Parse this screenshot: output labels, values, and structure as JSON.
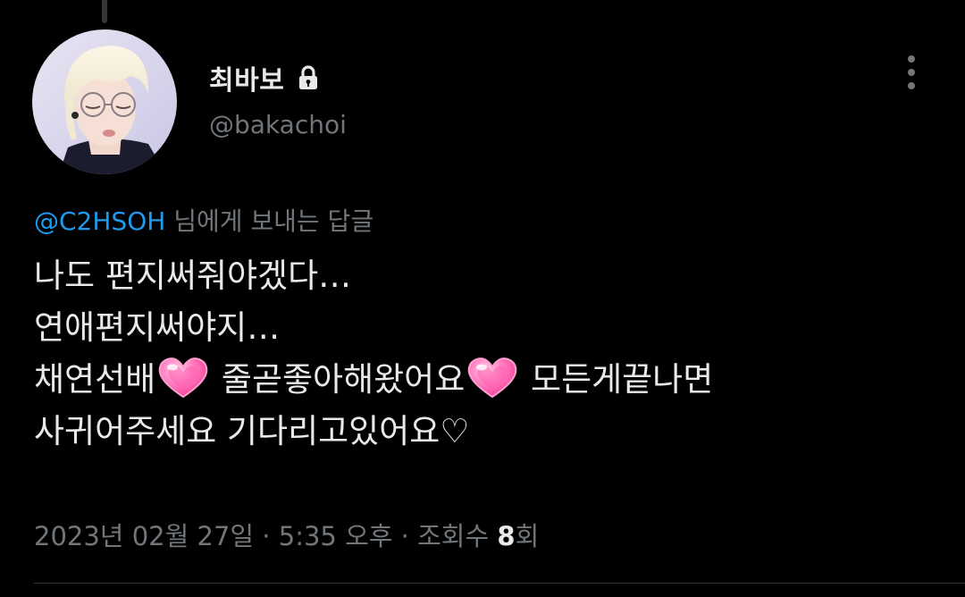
{
  "tweet": {
    "author": {
      "display_name": "최바보",
      "handle": "@bakachoi",
      "protected_icon": "lock-icon",
      "avatar": "profile-photo"
    },
    "more_icon": "more-vertical-icon",
    "reply_to": {
      "mention": "@C2HSOH",
      "suffix": " 님에게 보내는 답글"
    },
    "text": {
      "line1": "나도 편지써줘야겠다…",
      "line2": "연애편지써야지…",
      "line3a": "채연선배",
      "line3b": " 줄곧좋아해왔어요",
      "line3c": " 모든게끝나면",
      "line4": "사귀어주세요 기다리고있어요♡",
      "heart_icon": "growing-heart-emoji-icon"
    },
    "meta": {
      "date": "2023년 02월 27일",
      "separator1": " · ",
      "time": "5:35 오후",
      "separator2": " · ",
      "views_label": "조회수 ",
      "views_count": "8",
      "views_suffix": "회"
    }
  },
  "colors": {
    "background": "#000000",
    "primary_text": "#e7e9ea",
    "secondary_text": "#71767b",
    "link": "#1d9bf0",
    "heart_pink": "#ff4fa3"
  }
}
